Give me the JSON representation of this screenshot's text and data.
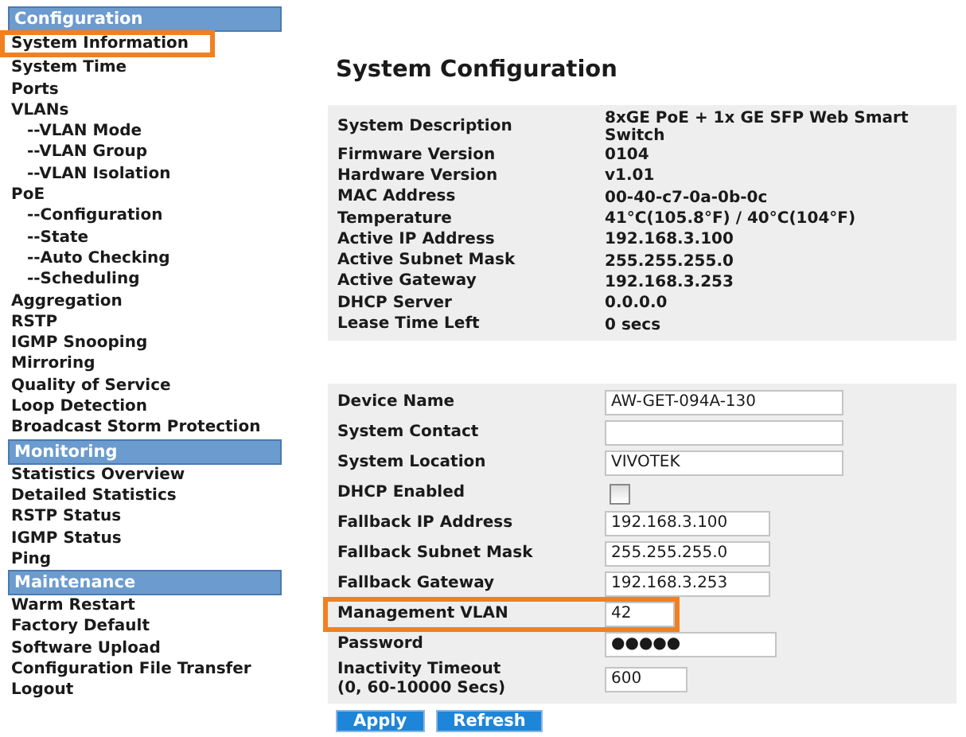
{
  "sidebar": {
    "sections": [
      {
        "title": "Configuration",
        "items": [
          {
            "label": "System Information",
            "highlighted": true
          },
          {
            "label": "System Time",
            "highlighted": false
          },
          {
            "label": "Ports",
            "highlighted": false
          },
          {
            "label": "VLANs",
            "highlighted": false,
            "children": [
              {
                "label": "--VLAN Mode",
                "highlighted": false
              },
              {
                "label": "--VLAN Group",
                "highlighted": false
              },
              {
                "label": "--VLAN Isolation",
                "highlighted": false
              }
            ]
          },
          {
            "label": "PoE",
            "highlighted": false,
            "children": [
              {
                "label": "--Configuration",
                "highlighted": false
              },
              {
                "label": "--State",
                "highlighted": false
              },
              {
                "label": "--Auto Checking",
                "highlighted": false
              },
              {
                "label": "--Scheduling",
                "highlighted": false
              }
            ]
          },
          {
            "label": "Aggregation",
            "highlighted": false
          },
          {
            "label": "RSTP",
            "highlighted": false
          },
          {
            "label": "IGMP Snooping",
            "highlighted": false
          },
          {
            "label": "Mirroring",
            "highlighted": false
          },
          {
            "label": "Quality of Service",
            "highlighted": false
          },
          {
            "label": "Loop Detection",
            "highlighted": false
          },
          {
            "label": "Broadcast Storm Protection",
            "highlighted": false
          }
        ]
      },
      {
        "title": "Monitoring",
        "items": [
          {
            "label": "Statistics Overview",
            "highlighted": false
          },
          {
            "label": "Detailed Statistics",
            "highlighted": false
          },
          {
            "label": "RSTP Status",
            "highlighted": false
          },
          {
            "label": "IGMP Status",
            "highlighted": false
          },
          {
            "label": "Ping",
            "highlighted": false
          }
        ]
      },
      {
        "title": "Maintenance",
        "items": [
          {
            "label": "Warm Restart",
            "highlighted": false
          },
          {
            "label": "Factory Default",
            "highlighted": false
          },
          {
            "label": "Software Upload",
            "highlighted": false
          },
          {
            "label": "Configuration File Transfer",
            "highlighted": false
          },
          {
            "label": "Logout",
            "highlighted": false
          }
        ]
      }
    ]
  },
  "page_title": "System Configuration",
  "info_table": [
    {
      "label": "System Description",
      "value": "8xGE PoE + 1x GE SFP Web Smart Switch"
    },
    {
      "label": "Firmware Version",
      "value": "0104"
    },
    {
      "label": "Hardware Version",
      "value": "v1.01"
    },
    {
      "label": "MAC Address",
      "value": "00-40-c7-0a-0b-0c"
    },
    {
      "label": "Temperature",
      "value": "41°C(105.8°F) / 40°C(104°F)"
    },
    {
      "label": "Active IP Address",
      "value": "192.168.3.100"
    },
    {
      "label": "Active Subnet Mask",
      "value": "255.255.255.0"
    },
    {
      "label": "Active Gateway",
      "value": "192.168.3.253"
    },
    {
      "label": "DHCP Server",
      "value": "0.0.0.0"
    },
    {
      "label": "Lease Time Left",
      "value": "0 secs"
    }
  ],
  "settings": [
    {
      "kind": "text",
      "label": "Device Name",
      "value": "AW-GET-094A-130",
      "highlighted": false
    },
    {
      "kind": "text",
      "label": "System Contact",
      "highlighted": false
    },
    {
      "kind": "text",
      "label": "System Location",
      "value": "VIVOTEK",
      "highlighted": false
    },
    {
      "kind": "checkbox",
      "label": "DHCP Enabled",
      "checked": false,
      "highlighted": false
    },
    {
      "kind": "text",
      "label": "Fallback IP Address",
      "value": "192.168.3.100",
      "highlighted": false
    },
    {
      "kind": "text",
      "label": "Fallback Subnet Mask",
      "value": "255.255.255.0",
      "highlighted": false
    },
    {
      "kind": "text",
      "label": "Fallback Gateway",
      "value": "192.168.3.253",
      "highlighted": false
    },
    {
      "kind": "text",
      "label": "Management VLAN",
      "value": "42",
      "highlighted": true
    },
    {
      "kind": "password",
      "label": "Password",
      "value": "●●●●●",
      "highlighted": false
    },
    {
      "kind": "text",
      "label": "Inactivity Timeout\n(0, 60-10000 Secs)",
      "value": "600",
      "highlighted": false
    }
  ],
  "buttons": [
    "Apply",
    "Refresh"
  ]
}
